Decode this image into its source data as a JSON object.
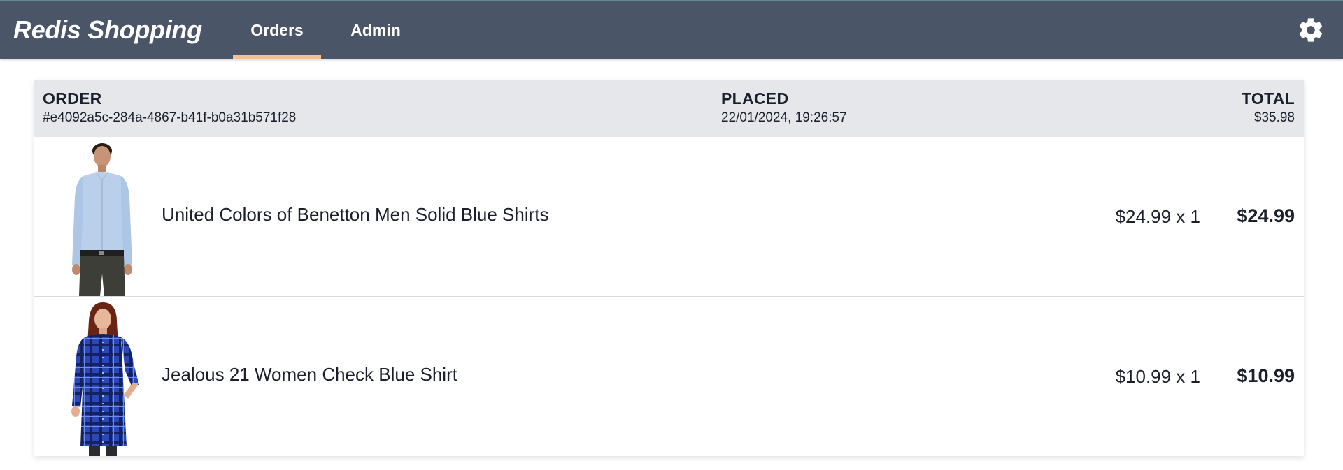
{
  "navbar": {
    "brand": "Redis Shopping",
    "tabs": [
      {
        "label": "Orders",
        "active": true
      },
      {
        "label": "Admin",
        "active": false
      }
    ],
    "settings_icon": "gear-icon"
  },
  "colors": {
    "navbar_bg": "#4a5568",
    "active_tab_underline": "#f6c18f",
    "order_header_bg": "#e6e7eb"
  },
  "order": {
    "order_label": "ORDER",
    "order_id": "#e4092a5c-284a-4867-b41f-b0a31b571f28",
    "placed_label": "PLACED",
    "placed_value": "22/01/2024, 19:26:57",
    "total_label": "TOTAL",
    "total_value": "$35.98",
    "items": [
      {
        "name": "United Colors of Benetton Men Solid Blue Shirts",
        "price_qty": "$24.99 x 1",
        "line_total": "$24.99",
        "image": "product-photo-man-blue-shirt"
      },
      {
        "name": "Jealous 21 Women Check Blue Shirt",
        "price_qty": "$10.99 x 1",
        "line_total": "$10.99",
        "image": "product-photo-woman-check-shirt"
      }
    ]
  }
}
